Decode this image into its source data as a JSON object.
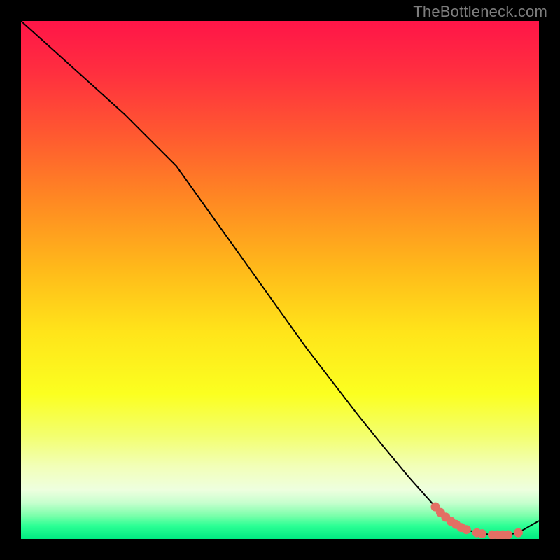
{
  "watermark": "TheBottleneck.com",
  "colors": {
    "frame": "#000000",
    "watermark": "#7d7d7d",
    "curve": "#000000",
    "marker_fill": "#e36f64",
    "marker_stroke": "#e36f64",
    "gradient_stops": [
      {
        "offset": 0.0,
        "color": "#ff1548"
      },
      {
        "offset": 0.1,
        "color": "#ff2f3f"
      },
      {
        "offset": 0.22,
        "color": "#ff5930"
      },
      {
        "offset": 0.35,
        "color": "#ff8a22"
      },
      {
        "offset": 0.48,
        "color": "#ffba1a"
      },
      {
        "offset": 0.6,
        "color": "#ffe41a"
      },
      {
        "offset": 0.72,
        "color": "#fbff20"
      },
      {
        "offset": 0.8,
        "color": "#f3ff6e"
      },
      {
        "offset": 0.86,
        "color": "#f2ffb8"
      },
      {
        "offset": 0.905,
        "color": "#eeffdf"
      },
      {
        "offset": 0.93,
        "color": "#c7ffce"
      },
      {
        "offset": 0.955,
        "color": "#7bffab"
      },
      {
        "offset": 0.975,
        "color": "#2bff94"
      },
      {
        "offset": 1.0,
        "color": "#00ea82"
      }
    ]
  },
  "chart_data": {
    "type": "line",
    "title": "",
    "xlabel": "",
    "ylabel": "",
    "xlim": [
      0,
      100
    ],
    "ylim": [
      0,
      100
    ],
    "grid": false,
    "series": [
      {
        "name": "bottleneck-curve",
        "x": [
          0,
          5,
          10,
          15,
          20,
          25,
          30,
          35,
          40,
          45,
          50,
          55,
          60,
          65,
          70,
          75,
          80,
          82,
          84,
          86,
          88,
          90,
          92,
          94,
          96,
          100
        ],
        "y": [
          100,
          95.5,
          91,
          86.5,
          82,
          77,
          72,
          65,
          58,
          51,
          44,
          37,
          30.5,
          24,
          17.8,
          11.8,
          6.2,
          4.2,
          2.8,
          1.8,
          1.2,
          0.9,
          0.8,
          0.8,
          1.2,
          3.5
        ]
      }
    ],
    "markers": [
      {
        "x": 80.0,
        "y": 6.2
      },
      {
        "x": 81.0,
        "y": 5.1
      },
      {
        "x": 82.0,
        "y": 4.2
      },
      {
        "x": 83.0,
        "y": 3.4
      },
      {
        "x": 84.0,
        "y": 2.8
      },
      {
        "x": 85.0,
        "y": 2.2
      },
      {
        "x": 86.0,
        "y": 1.8
      },
      {
        "x": 88.0,
        "y": 1.2
      },
      {
        "x": 89.0,
        "y": 1.0
      },
      {
        "x": 91.0,
        "y": 0.8
      },
      {
        "x": 92.0,
        "y": 0.8
      },
      {
        "x": 93.0,
        "y": 0.8
      },
      {
        "x": 94.0,
        "y": 0.8
      },
      {
        "x": 96.0,
        "y": 1.2
      }
    ]
  }
}
